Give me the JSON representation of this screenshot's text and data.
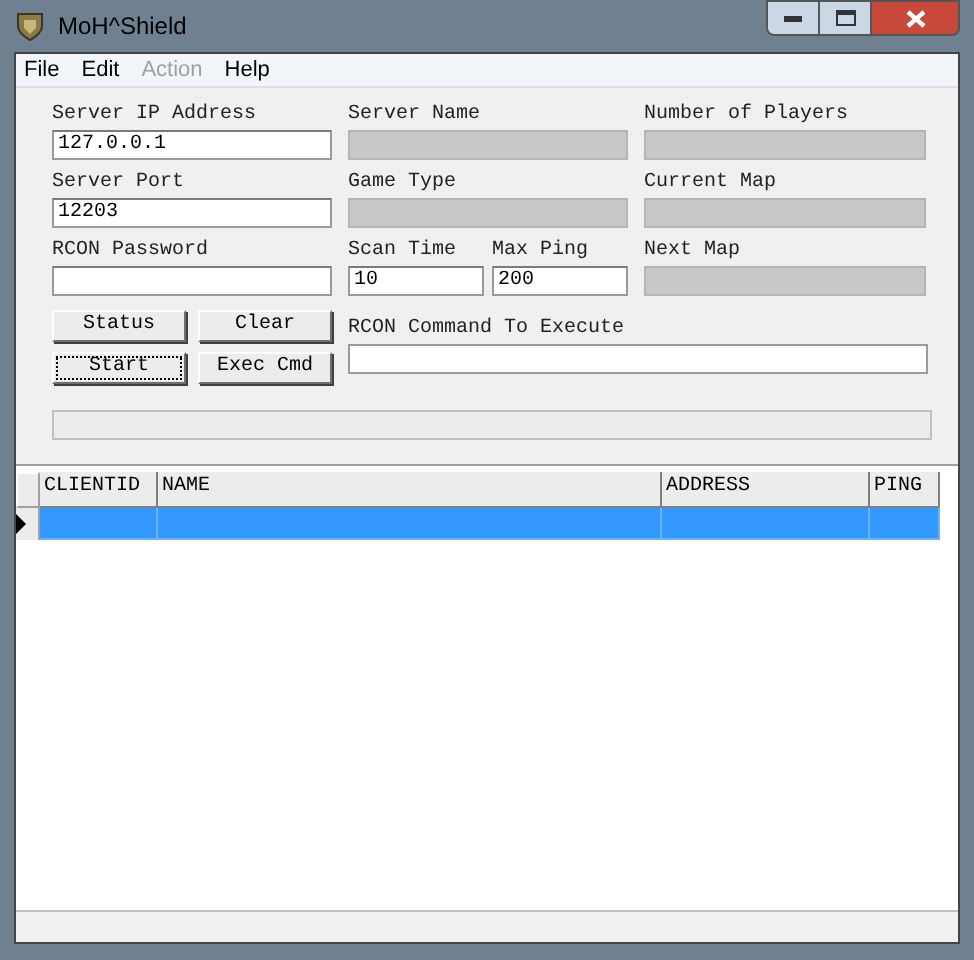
{
  "window": {
    "title": "MoH^Shield"
  },
  "menu": [
    {
      "label": "File",
      "disabled": false
    },
    {
      "label": "Edit",
      "disabled": false
    },
    {
      "label": "Action",
      "disabled": true
    },
    {
      "label": "Help",
      "disabled": false
    }
  ],
  "fields": [
    {
      "label": "Server IP Address",
      "value": "127.0.0.1",
      "readonly": false
    },
    {
      "label": "Server Name",
      "readonly": true
    },
    {
      "label": "Number of Players",
      "readonly": true
    },
    {
      "label": "Server Port",
      "value": "12203",
      "readonly": false
    },
    {
      "label": "Game Type",
      "readonly": true
    },
    {
      "label": "Current Map",
      "readonly": true
    },
    {
      "label": "RCON Password",
      "readonly": false
    },
    {
      "kind": "pair",
      "items": [
        {
          "label": "Scan Time",
          "value": "10",
          "readonly": false
        },
        {
          "label": "Max Ping",
          "value": "200",
          "readonly": false
        }
      ]
    },
    {
      "label": "Next Map",
      "readonly": true
    }
  ],
  "buttons": [
    {
      "label": "Status",
      "focused": false
    },
    {
      "label": "Clear",
      "focused": false
    },
    {
      "label": "Start",
      "focused": true
    },
    {
      "label": "Exec Cmd",
      "focused": false
    }
  ],
  "command": {
    "label": "RCON Command To Execute"
  },
  "table": {
    "columns": [
      "CLIENTID",
      "NAME",
      "ADDRESS",
      "PING"
    ],
    "rows": [
      {
        "selected": true,
        "current": true
      }
    ]
  }
}
